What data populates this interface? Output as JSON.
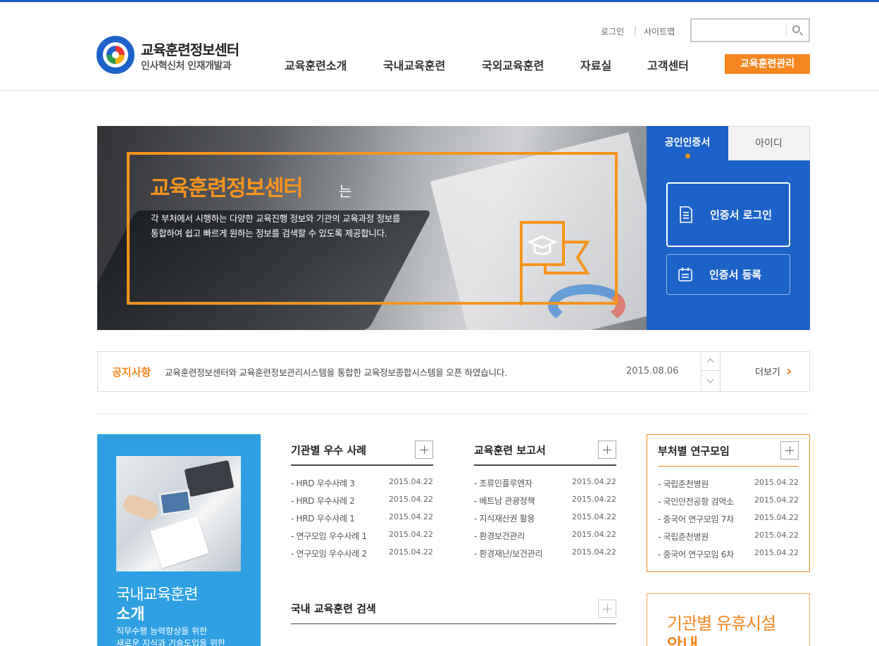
{
  "header": {
    "logo_title": "교육훈련정보센터",
    "logo_subtitle": "인사혁신처 인재개발과",
    "util_login": "로그인",
    "util_sep": "|",
    "util_sitemap": "사이트맵",
    "search_placeholder": "",
    "nav": [
      "교육훈련소개",
      "국내교육훈련",
      "국외교육훈련",
      "자료실",
      "고객센터"
    ],
    "nav_manage": "교육훈련관리"
  },
  "hero": {
    "title": "교육훈련정보센터",
    "title_suffix": "는",
    "desc_line1": "각 부처에서 시행하는 다양한 교육진행 정보와 기관의 교육과정 정보를",
    "desc_line2": "통합하여 쉽고 빠르게 원하는 정보를 검색할 수 있도록 제공합니다."
  },
  "login_panel": {
    "tab_cert": "공인인증서",
    "tab_id": "아이디",
    "btn_cert_login": "인증서 로그인",
    "btn_cert_register": "인증서 등록"
  },
  "notice": {
    "label": "공지사항",
    "text": "교육훈련정보센터와 교육훈련정보관리시스템을 통합한 교육정보종합시스템을 오픈 하였습니다.",
    "date": "2015.08.06",
    "more": "더보기"
  },
  "intro": {
    "title_line1": "국내교육훈련",
    "title_line2": "소개",
    "desc_line1": "직무수행 능력향상을 위한",
    "desc_line2": "새로운 지식과 기술도입을 위한"
  },
  "lists": [
    {
      "title": "기관별 우수 사례",
      "items": [
        {
          "title": "- HRD 우수사례 3",
          "date": "2015.04.22"
        },
        {
          "title": "- HRD 우수사례 2",
          "date": "2015.04.22"
        },
        {
          "title": "- HRD 우수사례 1",
          "date": "2015.04.22"
        },
        {
          "title": "- 연구모임 우수사례 1",
          "date": "2015.04.22"
        },
        {
          "title": "- 연구모임 우수사례 2",
          "date": "2015.04.22"
        }
      ]
    },
    {
      "title": "교육훈련 보고서",
      "items": [
        {
          "title": "- 조류인플루엔자",
          "date": "2015.04.22"
        },
        {
          "title": "- 베트남 관광정책",
          "date": "2015.04.22"
        },
        {
          "title": "- 지식재산권 활용",
          "date": "2015.04.22"
        },
        {
          "title": "- 환경보건관리",
          "date": "2015.04.22"
        },
        {
          "title": "- 환경재난/보건관리",
          "date": "2015.04.22"
        }
      ]
    },
    {
      "title": "부처별 연구모임",
      "items": [
        {
          "title": "- 국립춘천병원",
          "date": "2015.04.22"
        },
        {
          "title": "- 국민안전공항 검역소",
          "date": "2015.04.22"
        },
        {
          "title": "- 중국어 연구모임 7차",
          "date": "2015.04.22"
        },
        {
          "title": "- 국립춘천병원",
          "date": "2015.04.22"
        },
        {
          "title": "- 중국어 연구모임 6차",
          "date": "2015.04.22"
        }
      ]
    }
  ],
  "domestic_search": {
    "title": "국내 교육훈련 검색"
  },
  "facility": {
    "title_line1": "기관별 유휴시설",
    "title_line2": "안내"
  },
  "colors": {
    "primary_blue": "#1d62c8",
    "accent_orange": "#f5861f",
    "intro_blue": "#2fa0e2"
  },
  "icons": [
    "search-icon",
    "graduation-cap-icon",
    "certificate-doc-icon",
    "calendar-icon",
    "chevron-up-icon",
    "chevron-down-icon",
    "chevron-right-icon",
    "plus-icon"
  ]
}
